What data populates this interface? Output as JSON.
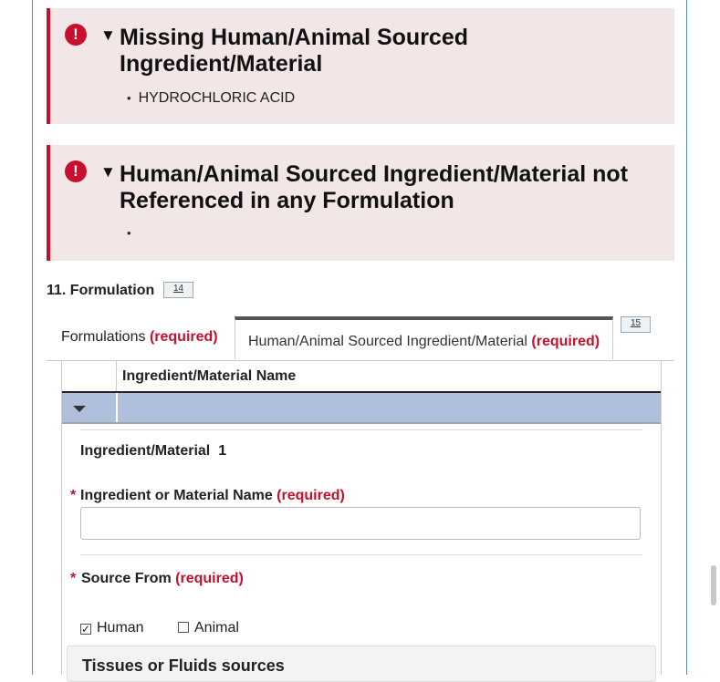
{
  "alerts": [
    {
      "title": "Missing Human/Animal Sourced Ingredient/Material",
      "items": [
        "HYDROCHLORIC ACID"
      ]
    },
    {
      "title": "Human/Animal Sourced Ingredient/Material not Referenced in any Formulation",
      "items": [
        ""
      ]
    }
  ],
  "section": {
    "title": "11. Formulation",
    "badge": "14"
  },
  "tabs": [
    {
      "label": "Formulations",
      "required": "(required)"
    },
    {
      "label": "Human/Animal Sourced Ingredient/Material",
      "required": "(required)",
      "active": true
    }
  ],
  "tab_badge": "15",
  "table": {
    "column_header": "Ingredient/Material Name"
  },
  "ingredient": {
    "title": "Ingredient/Material",
    "number": "1",
    "name_label": "Ingredient or Material Name",
    "name_required": "(required)",
    "name_value": "",
    "source_label": "Source From",
    "source_required": "(required)",
    "options": [
      {
        "label": "Human",
        "checked": true
      },
      {
        "label": "Animal",
        "checked": false
      }
    ]
  },
  "tissues": {
    "title": "Tissues or Fluids sources"
  },
  "colors": {
    "alert_bg": "#f2e6e6",
    "alert_accent": "#c8102e",
    "selected_row": "#b0bfdc",
    "required": "#c8102e"
  },
  "icons": {
    "alert": "exclamation-circle-icon",
    "collapse": "triangle-down-icon",
    "row_toggle": "caret-down-icon"
  }
}
